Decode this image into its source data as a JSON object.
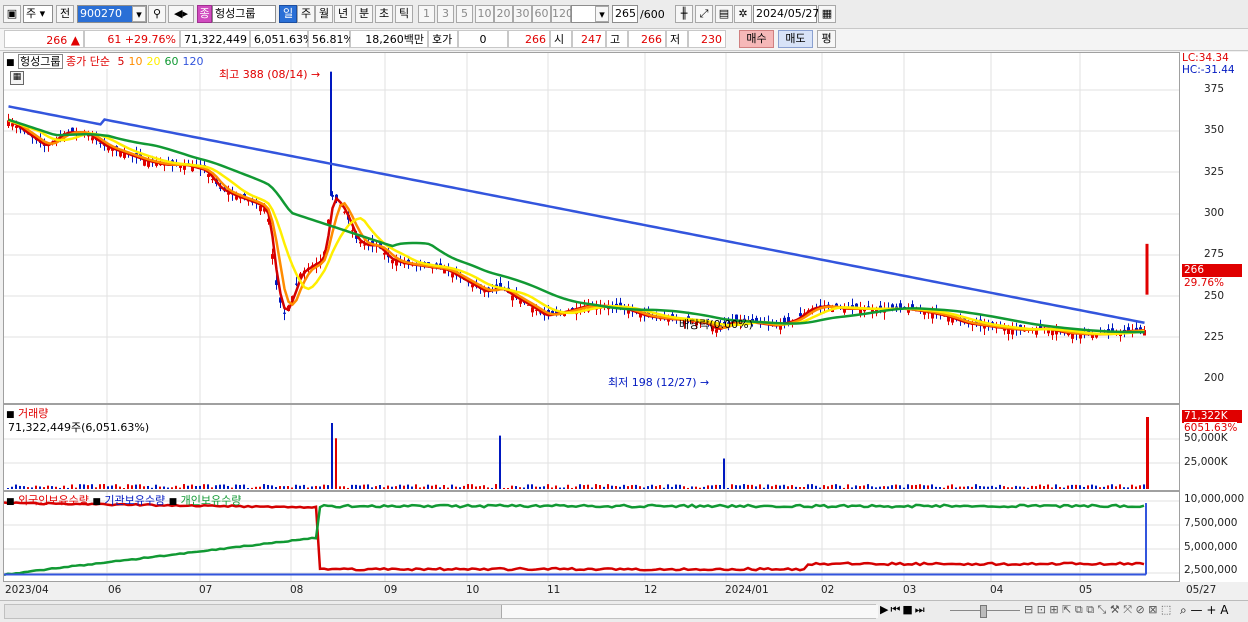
{
  "toolbar": {
    "period_label": "주",
    "prev_label": "전",
    "stock_code": "900270",
    "stock_name_badge": "종",
    "stock_name": "헝성그룹",
    "period_tabs": [
      "일",
      "주",
      "월",
      "년",
      "분",
      "초",
      "틱"
    ],
    "period_selected": "일",
    "interval_tabs": [
      "1",
      "3",
      "5",
      "10",
      "20",
      "30",
      "60",
      "120"
    ],
    "view_count": "265",
    "view_total": "/600",
    "date": "2024/05/27"
  },
  "quote": {
    "price": "266",
    "change": "61",
    "change_pct": "+29.76%",
    "volume": "71,322,449",
    "volume_ratio": "6,051.63%",
    "turnover_ratio": "56.81%",
    "amount": "18,260백만",
    "hoga_label": "호가",
    "hoga_value": "0",
    "hoga_price": "266",
    "open_label": "시",
    "open": "247",
    "high_label": "고",
    "high": "266",
    "low_label": "저",
    "low": "230",
    "buy_label": "매수",
    "sell_label": "매도",
    "avg_label": "평"
  },
  "price_panel": {
    "legend_name": "헝성그룹",
    "legend_type": "종가 단순",
    "ma_periods": [
      "5",
      "10",
      "20",
      "60",
      "120"
    ],
    "ma_colors": [
      "#d40000",
      "#ff8c00",
      "#ffee00",
      "#119933",
      "#3355dd"
    ],
    "lc": "LC:34.34",
    "hc": "HC:-31.44",
    "yticks": [
      "375",
      "350",
      "325",
      "300",
      "275",
      "250",
      "225",
      "200"
    ],
    "current_price_tag": "266",
    "current_pct_tag": "29.76%",
    "high_annotation": "최고 388 (08/14)",
    "low_annotation": "최저 198 (12/27)",
    "dividend_annotation": "배당락(0.00%)"
  },
  "volume_panel": {
    "title": "거래량",
    "value": "71,322,449주(6,051.63%)",
    "tag_value": "71,322K",
    "tag_pct": "6051.63%",
    "yticks": [
      "50,000K",
      "25,000K"
    ]
  },
  "holding_panel": {
    "series": [
      "외국인보유수량",
      "기관보유수량",
      "개인보유수량"
    ],
    "series_colors": [
      "#d40000",
      "#3355dd",
      "#119933"
    ],
    "yticks": [
      "10,000,000",
      "7,500,000",
      "5,000,000",
      "2,500,000"
    ]
  },
  "xaxis": {
    "labels": [
      "2023/04",
      "06",
      "07",
      "08",
      "09",
      "10",
      "11",
      "12",
      "2024/01",
      "02",
      "03",
      "04",
      "05",
      "05/27"
    ]
  },
  "colors": {
    "up": "#e00000",
    "down": "#0018c0",
    "selected": "#2a6fd6"
  }
}
